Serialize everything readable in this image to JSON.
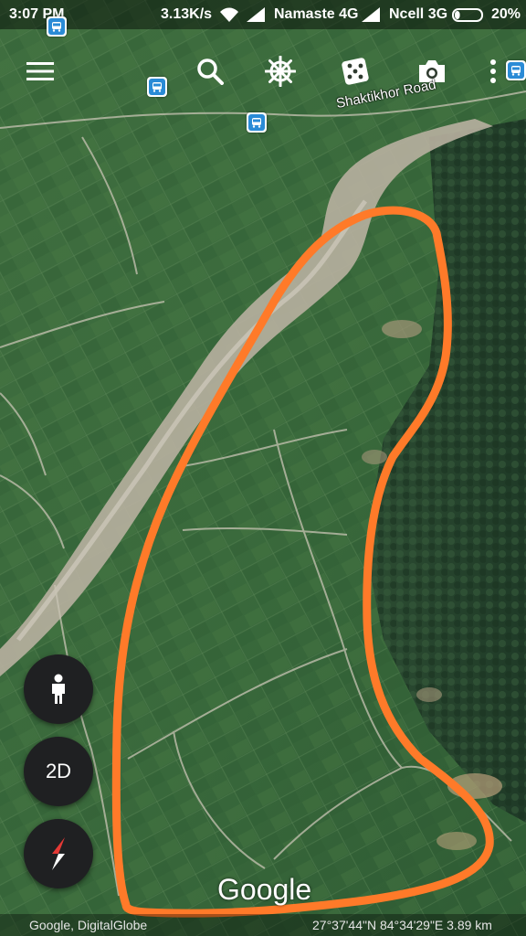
{
  "status_bar": {
    "time": "3:07 PM",
    "speed": "3.13K/s",
    "network1": "Namaste 4G",
    "network2": "Ncell 3G",
    "battery": "20%",
    "battery_level": 0.2
  },
  "toolbar": {
    "icons": [
      "menu-icon",
      "search-icon",
      "voyager-wheel-icon",
      "dice-icon",
      "camera-icon",
      "more-icon"
    ]
  },
  "map": {
    "road_label": "Shaktikhor Road",
    "google_logo": "Google",
    "attribution": "Google, DigitalGlobe",
    "coordinates": "27°37'44\"N 84°34'29\"E 3.89 km",
    "annotation_color": "#ff7a29"
  },
  "controls": {
    "pegman_icon": "pegman-icon",
    "toggle_2d_label": "2D",
    "compass_icon": "compass-icon"
  }
}
